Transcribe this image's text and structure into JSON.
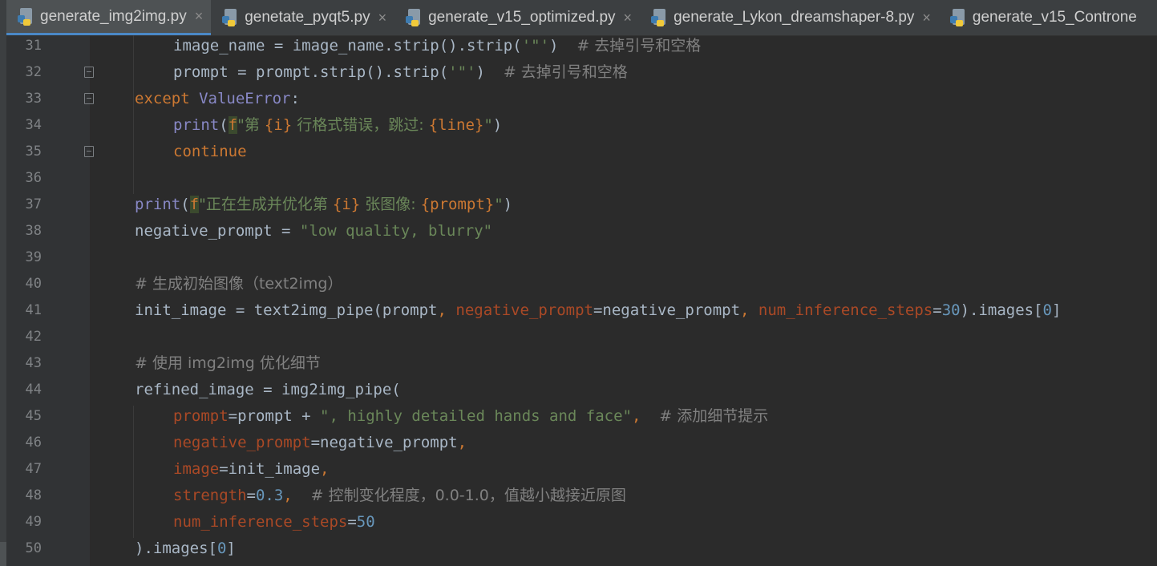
{
  "tabs": [
    {
      "label": "generate_img2img.py",
      "active": true,
      "close": "×"
    },
    {
      "label": "genetate_pyqt5.py",
      "active": false,
      "close": "×"
    },
    {
      "label": "generate_v15_optimized.py",
      "active": false,
      "close": "×"
    },
    {
      "label": "generate_Lykon_dreamshaper-8.py",
      "active": false,
      "close": "×"
    },
    {
      "label": "generate_v15_Controne",
      "active": false,
      "close": ""
    }
  ],
  "line_numbers": [
    "31",
    "32",
    "33",
    "34",
    "35",
    "36",
    "37",
    "38",
    "39",
    "40",
    "41",
    "42",
    "43",
    "44",
    "45",
    "46",
    "47",
    "48",
    "49",
    "50"
  ],
  "code": {
    "l31": {
      "a": "image_name = image_name.strip().strip(",
      "s": "'\"'",
      "b": ")  ",
      "c": "# 去掉引号和空格"
    },
    "l32": {
      "a": "prompt = prompt.strip().strip(",
      "s": "'\"'",
      "b": ")  ",
      "c": "# 去掉引号和空格"
    },
    "l33": {
      "kw": "except",
      "cls": "ValueError",
      "b": ":"
    },
    "l34": {
      "fn": "print",
      "p1": "(",
      "f": "f",
      "s1": "\"第 ",
      "v1": "{i}",
      "s2": " 行格式错误，跳过: ",
      "v2": "{line}",
      "s3": "\"",
      "p2": ")"
    },
    "l35": {
      "kw": "continue"
    },
    "l37": {
      "fn": "print",
      "p1": "(",
      "f": "f",
      "s1": "\"正在生成并优化第 ",
      "v1": "{i}",
      "s2": " 张图像: ",
      "v2": "{prompt}",
      "s3": "\"",
      "p2": ")"
    },
    "l38": {
      "a": "negative_prompt = ",
      "s": "\"low quality, blurry\""
    },
    "l40": {
      "c": "# 生成初始图像（text2img）"
    },
    "l41": {
      "a": "init_image = text2img_pipe(prompt",
      "k1": ", ",
      "p1": "negative_prompt",
      "e1": "=negative_prompt",
      "k2": ", ",
      "p2": "num_inference_steps",
      "e2": "=",
      "n": "30",
      "b": ").images[",
      "n2": "0",
      "z": "]"
    },
    "l43": {
      "c": "# 使用 img2img 优化细节"
    },
    "l44": {
      "a": "refined_image = img2img_pipe("
    },
    "l45": {
      "p": "prompt",
      "a": "=prompt + ",
      "s": "\", highly detailed hands and face\"",
      "k": ",  ",
      "c": "# 添加细节提示"
    },
    "l46": {
      "p": "negative_prompt",
      "a": "=negative_prompt",
      "k": ","
    },
    "l47": {
      "p": "image",
      "a": "=init_image",
      "k": ","
    },
    "l48": {
      "p": "strength",
      "a": "=",
      "n": "0.3",
      "k": ",  ",
      "c": "# 控制变化程度，0.0-1.0，值越小越接近原图"
    },
    "l49": {
      "p": "num_inference_steps",
      "a": "=",
      "n": "50"
    },
    "l50": {
      "a": ").images[",
      "n": "0",
      "z": "]"
    }
  },
  "colors": {
    "background": "#2b2b2b",
    "keyword": "#cc7832",
    "string": "#6a8759",
    "number": "#6897bb",
    "comment": "#808080",
    "param": "#aa4926",
    "builtin": "#8888c6",
    "active_tab_underline": "#4a88c7"
  },
  "icons": {
    "tab_file": "python-file-icon",
    "fold": "fold-marker-icon"
  }
}
